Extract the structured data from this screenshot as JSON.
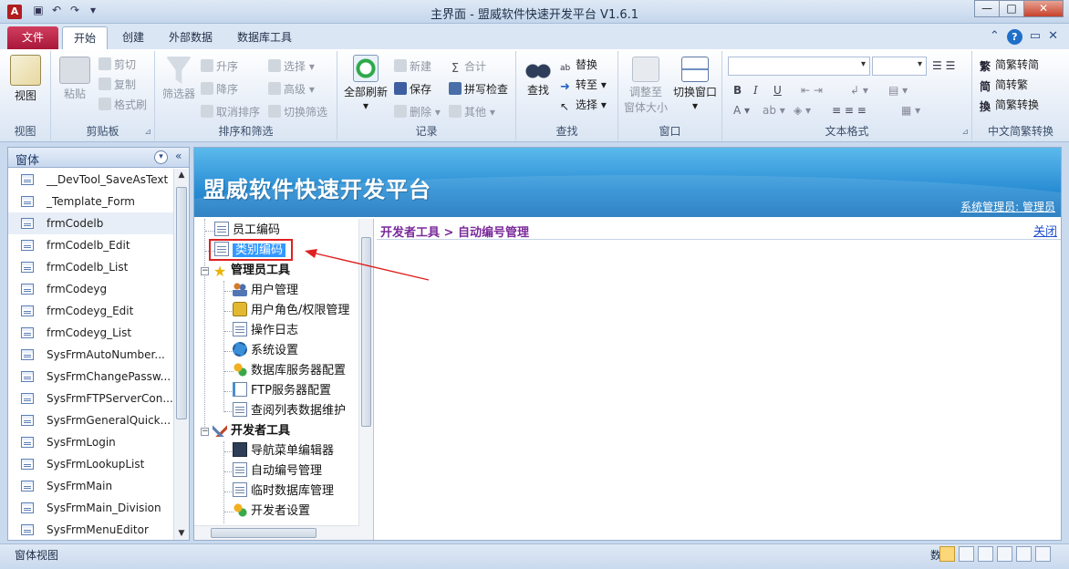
{
  "window": {
    "title": "主界面 - 盟威软件快速开发平台 V1.6.1",
    "app_icon": "A"
  },
  "ribbon_tabs": [
    "文件",
    "开始",
    "创建",
    "外部数据",
    "数据库工具"
  ],
  "ribbon": {
    "view": {
      "label": "视图",
      "group": "视图"
    },
    "clipboard": {
      "paste": "粘贴",
      "cut": "剪切",
      "copy": "复制",
      "format_painter": "格式刷",
      "group": "剪贴板"
    },
    "sort_filter": {
      "filter": "筛选器",
      "ascending": "升序",
      "descending": "降序",
      "remove_sort": "取消排序",
      "select": "选择",
      "advanced": "高级",
      "toggle_filter": "切换筛选",
      "group": "排序和筛选"
    },
    "records": {
      "refresh_all": "全部刷新",
      "new": "新建",
      "save": "保存",
      "delete": "删除",
      "totals": "合计",
      "spelling": "拼写检查",
      "more": "其他",
      "group": "记录"
    },
    "find": {
      "find": "查找",
      "replace": "替换",
      "goto": "转至",
      "select": "选择",
      "group": "查找"
    },
    "window": {
      "size_to_fit": "调整至",
      "size_to_fit_2": "窗体大小",
      "switch": "切换窗口",
      "group": "窗口"
    },
    "text_format": {
      "bold": "B",
      "italic": "I",
      "underline": "U",
      "font_color": "A",
      "group": "文本格式"
    },
    "chinese": {
      "to_traditional": "简繁转简",
      "to_simplified": "简转繁",
      "convert": "简繁转换",
      "group": "中文简繁转换"
    }
  },
  "nav_pane": {
    "header": "窗体",
    "items": [
      "__DevTool_SaveAsText",
      "_Template_Form",
      "frmCodelb",
      "frmCodelb_Edit",
      "frmCodelb_List",
      "frmCodeyg",
      "frmCodeyg_Edit",
      "frmCodeyg_List",
      "SysFrmAutoNumber...",
      "SysFrmChangePassw...",
      "SysFrmFTPServerCon...",
      "SysFrmGeneralQuick...",
      "SysFrmLogin",
      "SysFrmLookupList",
      "SysFrmMain",
      "SysFrmMain_Division",
      "SysFrmMenuEditor"
    ]
  },
  "banner": {
    "brand": "盟威软件快速开发平台",
    "user": "系统管理员: 管理员"
  },
  "tree": {
    "employee_code": "员工编码",
    "category_code": "类别编码",
    "admin_tools": "管理员工具",
    "admin_items": [
      "用户管理",
      "用户角色/权限管理",
      "操作日志",
      "系统设置",
      "数据库服务器配置",
      "FTP服务器配置",
      "查阅列表数据维护"
    ],
    "dev_tools": "开发者工具",
    "dev_items": [
      "导航菜单编辑器",
      "自动编号管理",
      "临时数据库管理",
      "开发者设置"
    ]
  },
  "content": {
    "breadcrumb": "开发者工具 > 自动编号管理",
    "close": "关闭"
  },
  "statusbar": {
    "left": "窗体视图",
    "mode": "数字"
  },
  "colors": {
    "file_tab": "#b8204a",
    "banner": "#2a8ed4",
    "breadcrumb": "#7a2a9a",
    "highlight_box": "#e02020",
    "selected_node": "#3399ff"
  }
}
